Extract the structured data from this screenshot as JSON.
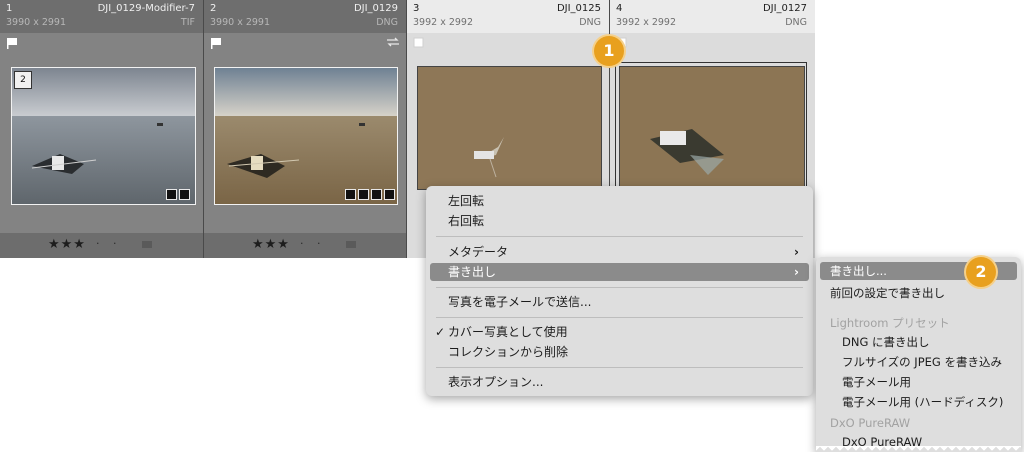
{
  "filmstrip": {
    "cells": [
      {
        "index": "1",
        "filename": "DJI_0129-Modifier-7",
        "dimensions": "3990 x 2991",
        "filetype": "TIF",
        "stack_count": "2",
        "rating": "★★★",
        "dots": "· ·"
      },
      {
        "index": "2",
        "filename": "DJI_0129",
        "dimensions": "3990 x 2991",
        "filetype": "DNG",
        "rating": "★★★",
        "dots": "· ·"
      },
      {
        "index": "3",
        "filename": "DJI_0125",
        "dimensions": "3992 x 2992",
        "filetype": "DNG"
      },
      {
        "index": "4",
        "filename": "DJI_0127",
        "dimensions": "3992 x 2992",
        "filetype": "DNG"
      }
    ]
  },
  "callouts": {
    "first": "1",
    "second": "2"
  },
  "context_menu": {
    "rotate_left": "左回転",
    "rotate_right": "右回転",
    "metadata": "メタデータ",
    "export": "書き出し",
    "email_photo": "写真を電子メールで送信...",
    "use_as_cover": "カバー写真として使用",
    "remove_from_collection": "コレクションから削除",
    "view_options": "表示オプション..."
  },
  "export_submenu": {
    "export_ellipsis": "書き出し...",
    "export_with_previous": "前回の設定で書き出し",
    "lightroom_presets_header": "Lightroom プリセット",
    "preset_dng": "DNG に書き出し",
    "preset_jpeg": "フルサイズの JPEG を書き込み",
    "preset_email": "電子メール用",
    "preset_email_hd": "電子メール用 (ハードディスク)",
    "dxo_header": "DxO PureRAW",
    "dxo_item": "DxO PureRAW"
  },
  "colors": {
    "accent_callout": "#e8a01f",
    "menu_highlight": "#8b8b8b"
  }
}
